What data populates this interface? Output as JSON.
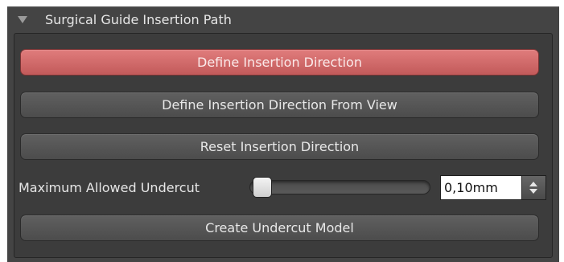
{
  "panel": {
    "title": "Surgical Guide Insertion Path"
  },
  "buttons": {
    "define_direction": "Define Insertion Direction",
    "define_from_view": "Define Insertion Direction From View",
    "reset_direction": "Reset Insertion Direction",
    "create_undercut_model": "Create Undercut Model"
  },
  "undercut": {
    "label": "Maximum Allowed Undercut",
    "slider_fraction": 0.0,
    "value": "0,10mm"
  },
  "colors": {
    "active_button": "#d66b6b",
    "panel_background": "#444444"
  },
  "icons": {
    "collapse": "triangle-down-icon",
    "spin_up": "arrow-up-icon",
    "spin_down": "arrow-down-icon"
  }
}
